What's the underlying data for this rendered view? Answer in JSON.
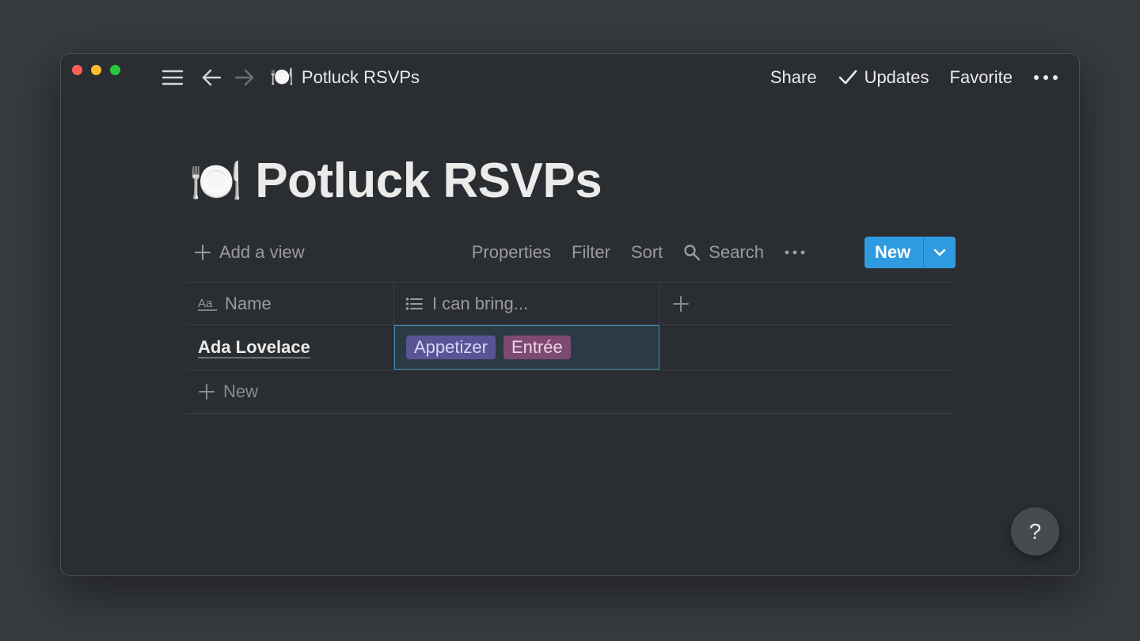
{
  "window": {
    "breadcrumb": {
      "emoji": "🍽️",
      "title": "Potluck RSVPs"
    },
    "topbar": {
      "share": "Share",
      "updates": "Updates",
      "favorite": "Favorite"
    }
  },
  "page": {
    "emoji": "🍽️",
    "title": "Potluck RSVPs"
  },
  "toolbar": {
    "add_view": "Add a view",
    "properties": "Properties",
    "filter": "Filter",
    "sort": "Sort",
    "search": "Search",
    "new": "New"
  },
  "table": {
    "columns": [
      {
        "label": "Name",
        "icon": "text-type-icon"
      },
      {
        "label": "I can bring...",
        "icon": "list-icon"
      }
    ],
    "rows": [
      {
        "name": "Ada Lovelace",
        "tags": [
          {
            "label": "Appetizer",
            "color": "#5a5495"
          },
          {
            "label": "Entrée",
            "color": "#7e4a72"
          }
        ]
      }
    ],
    "new_row": "New"
  },
  "help": "?",
  "colors": {
    "accent": "#2e9be0",
    "background": "#2a2d31"
  }
}
